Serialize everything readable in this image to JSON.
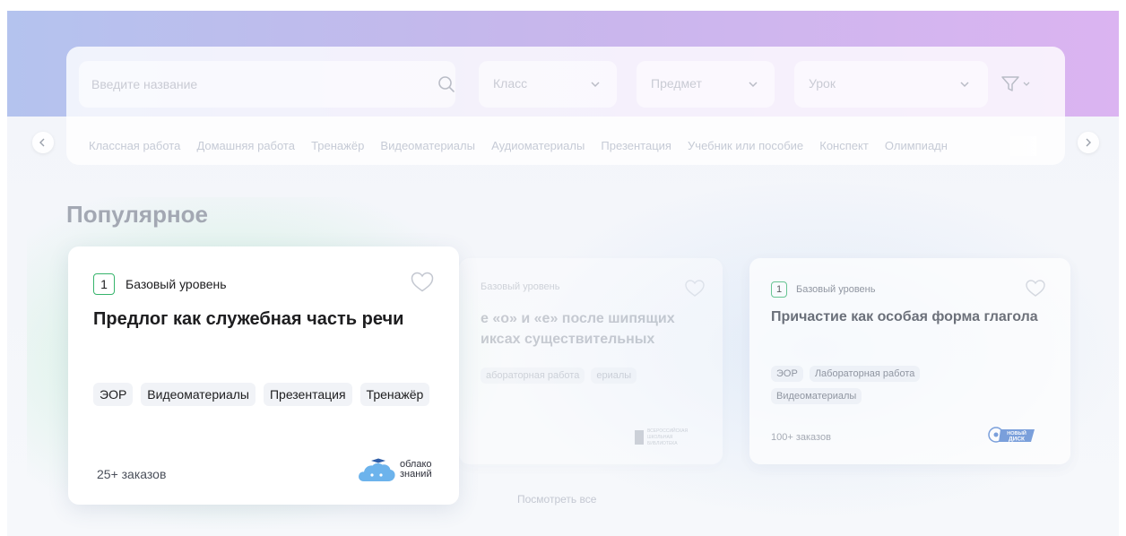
{
  "search": {
    "placeholder": "Введите название",
    "class_label": "Класс",
    "subject_label": "Предмет",
    "lesson_label": "Урок"
  },
  "chips": [
    "Классная работа",
    "Домашняя работа",
    "Тренажёр",
    "Видеоматериалы",
    "Аудиоматериалы",
    "Презентация",
    "Учебник или пособие",
    "Конспект",
    "Олимпиадн"
  ],
  "section": {
    "title": "Популярное",
    "view_all": "Посмотреть все"
  },
  "cards": [
    {
      "level_num": "1",
      "level_text": "Базовый уровень",
      "title": "Предлог как служебная часть речи",
      "tags": [
        "ЭОР",
        "Видеоматериалы",
        "Презентация",
        "Тренажёр"
      ],
      "orders": "25+ заказов",
      "publisher_line1": "облако",
      "publisher_line2": "знаний"
    },
    {
      "level_text": "Базовый уровень",
      "title_line1": "е «о» и «е» после шипящих",
      "title_line2": "иксах существительных",
      "tags": [
        "абораторная работа",
        "ериалы"
      ],
      "orders": "",
      "publisher_line1": "ВСЕРОССИЙСКАЯ",
      "publisher_line2": "ШКОЛЬНАЯ",
      "publisher_line3": "БИБЛИОТЕКА"
    },
    {
      "level_num": "1",
      "level_text": "Базовый уровень",
      "title": "Причастие как особая форма глагола",
      "tags": [
        "ЭОР",
        "Лабораторная работа",
        "Видеоматериалы"
      ],
      "orders": "100+ заказов",
      "publisher_line1": "НОВЫЙ",
      "publisher_line2": "ДИСК"
    }
  ],
  "colors": {
    "accent_green": "#36b46b",
    "header_gradient_start": "#b4c3ee",
    "header_gradient_end": "#dbb4f1"
  }
}
